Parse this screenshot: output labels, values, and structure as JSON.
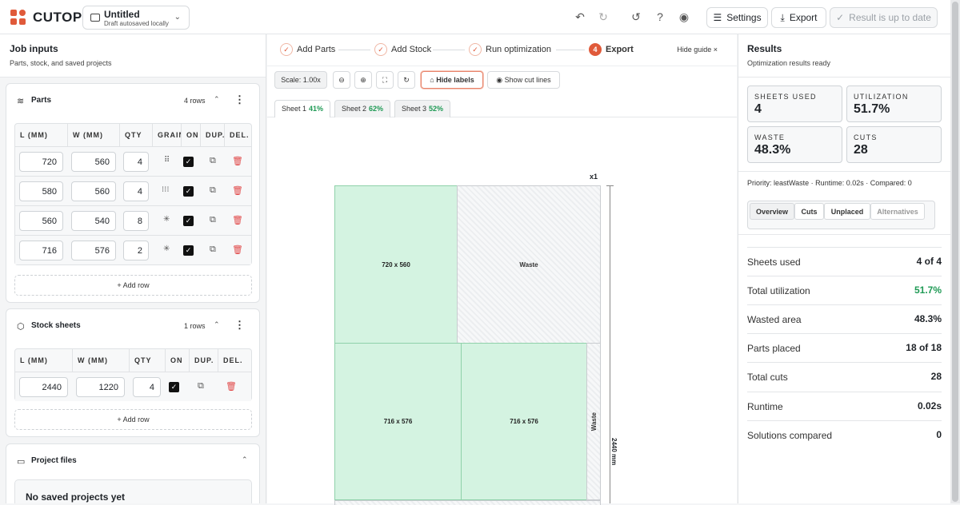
{
  "app": {
    "name": "CUTOPS"
  },
  "project": {
    "title": "Untitled",
    "subtitle": "Draft autosaved locally"
  },
  "toolbar": {
    "settings": "Settings",
    "export": "Export",
    "status": "Result is up to date"
  },
  "left": {
    "title": "Job inputs",
    "subtitle": "Parts, stock, and saved projects",
    "parts": {
      "title": "Parts",
      "rows_label": "4 rows",
      "headers": [
        "L (MM)",
        "W (MM)",
        "QTY",
        "GRAIN",
        "ON",
        "DUP.",
        "DEL."
      ],
      "rows": [
        {
          "l": "720",
          "w": "560",
          "qty": "4",
          "grain": "⠿"
        },
        {
          "l": "580",
          "w": "560",
          "qty": "4",
          "grain": "⁝⁝⁝"
        },
        {
          "l": "560",
          "w": "540",
          "qty": "8",
          "grain": "✳"
        },
        {
          "l": "716",
          "w": "576",
          "qty": "2",
          "grain": "✳"
        }
      ],
      "add_row": "Add row"
    },
    "stock": {
      "title": "Stock sheets",
      "rows_label": "1 rows",
      "headers": [
        "L (MM)",
        "W (MM)",
        "QTY",
        "ON",
        "DUP.",
        "DEL."
      ],
      "rows": [
        {
          "l": "2440",
          "w": "1220",
          "qty": "4"
        }
      ],
      "add_row": "Add row"
    },
    "files": {
      "title": "Project files",
      "empty": "No saved projects yet"
    }
  },
  "guide": {
    "steps": [
      {
        "num": "✓",
        "label": "Add Parts"
      },
      {
        "num": "✓",
        "label": "Add Stock"
      },
      {
        "num": "✓",
        "label": "Run optimization"
      },
      {
        "num": "4",
        "label": "Export"
      }
    ],
    "hide": "Hide guide ×"
  },
  "view_tools": {
    "scale": "Scale: 1.00x",
    "hide_labels": "Hide labels",
    "show_cut_lines": "Show cut lines"
  },
  "sheets": [
    {
      "name": "Sheet 1",
      "pct": "41%"
    },
    {
      "name": "Sheet 2",
      "pct": "62%"
    },
    {
      "name": "Sheet 3",
      "pct": "52%"
    }
  ],
  "layout": {
    "multiplier": "x1",
    "dimension": "2440 mm",
    "pieces": [
      "720 x 560",
      "716 x 576",
      "716 x 576"
    ],
    "waste_label": "Waste"
  },
  "results": {
    "title": "Results",
    "subtitle": "Optimization results ready",
    "stats": [
      {
        "label": "SHEETS USED",
        "value": "4"
      },
      {
        "label": "UTILIZATION",
        "value": "51.7%"
      },
      {
        "label": "WASTE",
        "value": "48.3%"
      },
      {
        "label": "CUTS",
        "value": "28"
      }
    ],
    "meta": "Priority: leastWaste · Runtime: 0.02s · Compared: 0",
    "tabs": [
      "Overview",
      "Cuts",
      "Unplaced",
      "Alternatives"
    ],
    "summary": [
      {
        "k": "Sheets used",
        "v": "4 of 4"
      },
      {
        "k": "Total utilization",
        "v": "51.7%"
      },
      {
        "k": "Wasted area",
        "v": "48.3%"
      },
      {
        "k": "Parts placed",
        "v": "18 of 18"
      },
      {
        "k": "Total cuts",
        "v": "28"
      },
      {
        "k": "Runtime",
        "v": "0.02s"
      },
      {
        "k": "Solutions compared",
        "v": "0"
      }
    ],
    "highlight_color": "#1f9a55"
  }
}
